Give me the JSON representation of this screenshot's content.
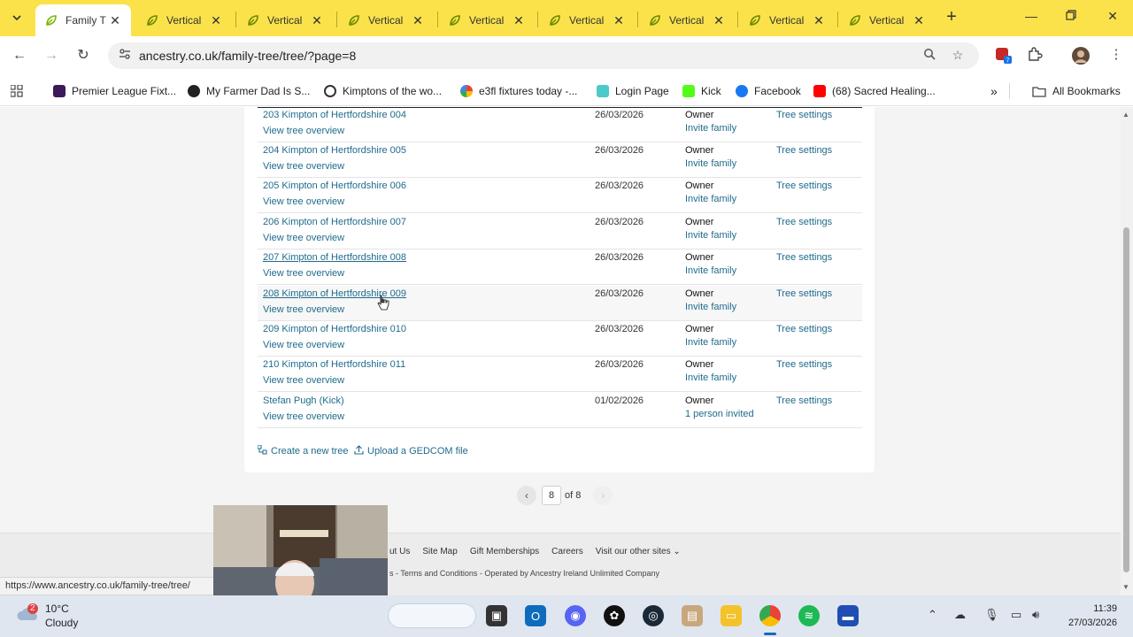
{
  "browser": {
    "tabs": [
      {
        "title": "Family T",
        "active": true
      },
      {
        "title": "Vertical"
      },
      {
        "title": "Vertical"
      },
      {
        "title": "Vertical"
      },
      {
        "title": "Vertical"
      },
      {
        "title": "Vertical"
      },
      {
        "title": "Vertical"
      },
      {
        "title": "Vertical"
      },
      {
        "title": "Vertical"
      }
    ],
    "url": "ancestry.co.uk/family-tree/tree/?page=8",
    "bookmarks": [
      {
        "label": "Premier League Fixt...",
        "color": "#3d195b"
      },
      {
        "label": "My Farmer Dad Is S...",
        "color": "#222222"
      },
      {
        "label": "Kimptons of the wo...",
        "color": "#333333"
      },
      {
        "label": "e3fl fixtures today -...",
        "color": "#4285f4"
      },
      {
        "label": "Login Page",
        "color": "#4cc9c9"
      },
      {
        "label": "Kick",
        "color": "#53fc18"
      },
      {
        "label": "Facebook",
        "color": "#1877f2"
      },
      {
        "label": "(68) Sacred Healing...",
        "color": "#ff0000"
      }
    ],
    "all_bookmarks": "All Bookmarks"
  },
  "trees": [
    {
      "name": "203 Kimpton of Hertfordshire 004",
      "overview": "View tree overview",
      "date": "26/03/2026",
      "role": "Owner",
      "invite": "Invite family",
      "settings": "Tree settings"
    },
    {
      "name": "204 Kimpton of Hertfordshire 005",
      "overview": "View tree overview",
      "date": "26/03/2026",
      "role": "Owner",
      "invite": "Invite family",
      "settings": "Tree settings"
    },
    {
      "name": "205 Kimpton of Hertfordshire 006",
      "overview": "View tree overview",
      "date": "26/03/2026",
      "role": "Owner",
      "invite": "Invite family",
      "settings": "Tree settings"
    },
    {
      "name": "206 Kimpton of Hertfordshire 007",
      "overview": "View tree overview",
      "date": "26/03/2026",
      "role": "Owner",
      "invite": "Invite family",
      "settings": "Tree settings"
    },
    {
      "name": "207 Kimpton of Hertfordshire 008",
      "overview": "View tree overview",
      "date": "26/03/2026",
      "role": "Owner",
      "invite": "Invite family",
      "settings": "Tree settings"
    },
    {
      "name": "208 Kimpton of Hertfordshire 009",
      "overview": "View tree overview",
      "date": "26/03/2026",
      "role": "Owner",
      "invite": "Invite family",
      "settings": "Tree settings"
    },
    {
      "name": "209 Kimpton of Hertfordshire 010",
      "overview": "View tree overview",
      "date": "26/03/2026",
      "role": "Owner",
      "invite": "Invite family",
      "settings": "Tree settings"
    },
    {
      "name": "210 Kimpton of Hertfordshire 011",
      "overview": "View tree overview",
      "date": "26/03/2026",
      "role": "Owner",
      "invite": "Invite family",
      "settings": "Tree settings"
    },
    {
      "name": "Stefan Pugh (Kick)",
      "overview": "View tree overview",
      "date": "01/02/2026",
      "role": "Owner",
      "invite": "1 person invited",
      "settings": "Tree settings"
    }
  ],
  "actions": {
    "create": "Create a new tree",
    "upload": "Upload a GEDCOM file"
  },
  "pagination": {
    "current": "8",
    "of_text": "of 8"
  },
  "footer": {
    "links": [
      "ut Us",
      "Site Map",
      "Gift Memberships",
      "Careers",
      "Visit our other sites"
    ],
    "legal": "s - Terms and Conditions - Operated by Ancestry Ireland Unlimited Company"
  },
  "status_url": "https://www.ancestry.co.uk/family-tree/tree/",
  "taskbar": {
    "weather_temp": "10°C",
    "weather_desc": "Cloudy",
    "weather_badge": "2",
    "time": "11:39",
    "date": "27/03/2026"
  }
}
